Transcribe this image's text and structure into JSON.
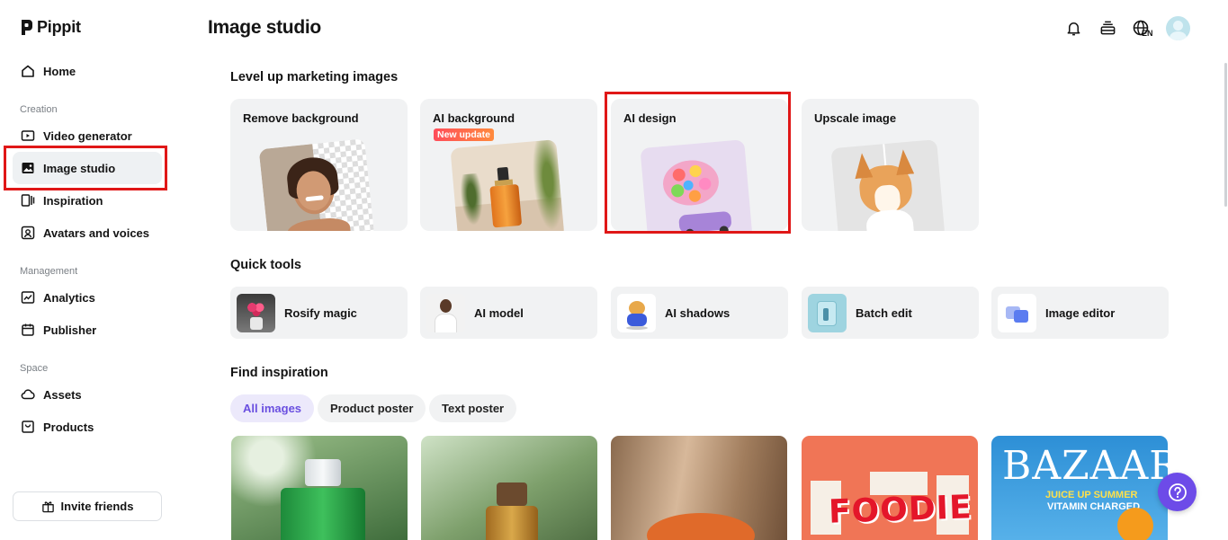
{
  "brand": {
    "name": "Pippit"
  },
  "sidebar": {
    "home": "Home",
    "creation_label": "Creation",
    "creation_items": [
      "Video generator",
      "Image studio",
      "Inspiration",
      "Avatars and voices"
    ],
    "management_label": "Management",
    "management_items": [
      "Analytics",
      "Publisher"
    ],
    "space_label": "Space",
    "space_items": [
      "Assets",
      "Products"
    ],
    "active_item": "Image studio",
    "invite_label": "Invite friends"
  },
  "header": {
    "title": "Image studio",
    "language": "EN",
    "icons": [
      "bell-icon",
      "stack-icon",
      "globe-icon",
      "avatar"
    ]
  },
  "marketing": {
    "heading": "Level up marketing images",
    "cards": [
      {
        "title": "Remove background"
      },
      {
        "title": "AI background",
        "badge": "New update"
      },
      {
        "title": "AI design"
      },
      {
        "title": "Upscale image"
      }
    ]
  },
  "quick_tools": {
    "heading": "Quick tools",
    "items": [
      "Rosify magic",
      "AI model",
      "AI shadows",
      "Batch edit",
      "Image editor"
    ]
  },
  "inspiration": {
    "heading": "Find inspiration",
    "chips": [
      "All images",
      "Product poster",
      "Text poster"
    ],
    "active_chip": "All images",
    "posters": [
      {
        "text": ""
      },
      {
        "text": ""
      },
      {
        "text": ""
      },
      {
        "text": "FOODIE"
      },
      {
        "text": "BAZAAR",
        "sub1": "JUICE UP SUMMER",
        "sub2": "VITAMIN CHARGED"
      }
    ]
  },
  "colors": {
    "highlight": "#e01717",
    "accent_purple": "#6d4be8",
    "chip_active_bg": "#ece9fb",
    "card_bg": "#f1f2f3"
  }
}
